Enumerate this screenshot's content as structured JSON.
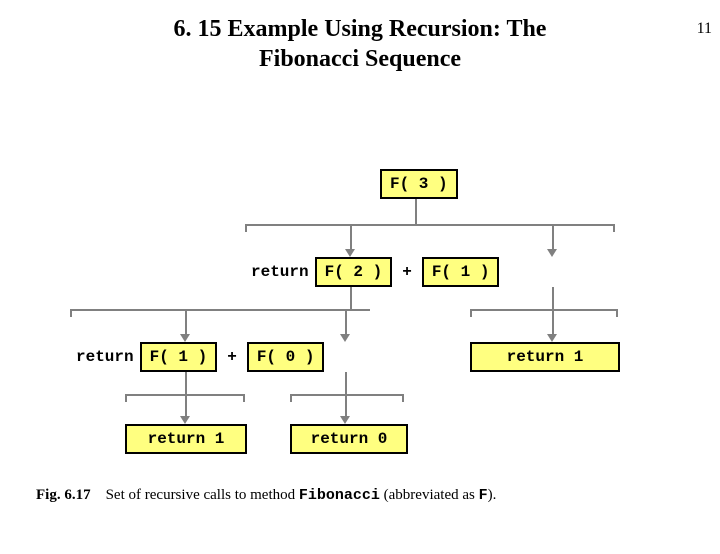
{
  "page_number": "11",
  "title_line1": "6. 15  Example Using Recursion: The",
  "title_line2": "Fibonacci Sequence",
  "labels": {
    "return": "return",
    "plus": "+"
  },
  "nodes": {
    "f3": "F( 3 )",
    "f2": "F( 2 )",
    "f1_right": "F( 1 )",
    "f1_left": "F( 1 )",
    "f0": "F( 0 )",
    "ret1_right": "return 1",
    "ret1_left": "return 1",
    "ret0": "return 0"
  },
  "caption": {
    "fignum": "Fig. 6.17",
    "text_before": "Set of recursive calls to method ",
    "mono": "Fibonacci",
    "text_after": " (abbreviated as ",
    "mono2": "F",
    "tail": ")."
  }
}
